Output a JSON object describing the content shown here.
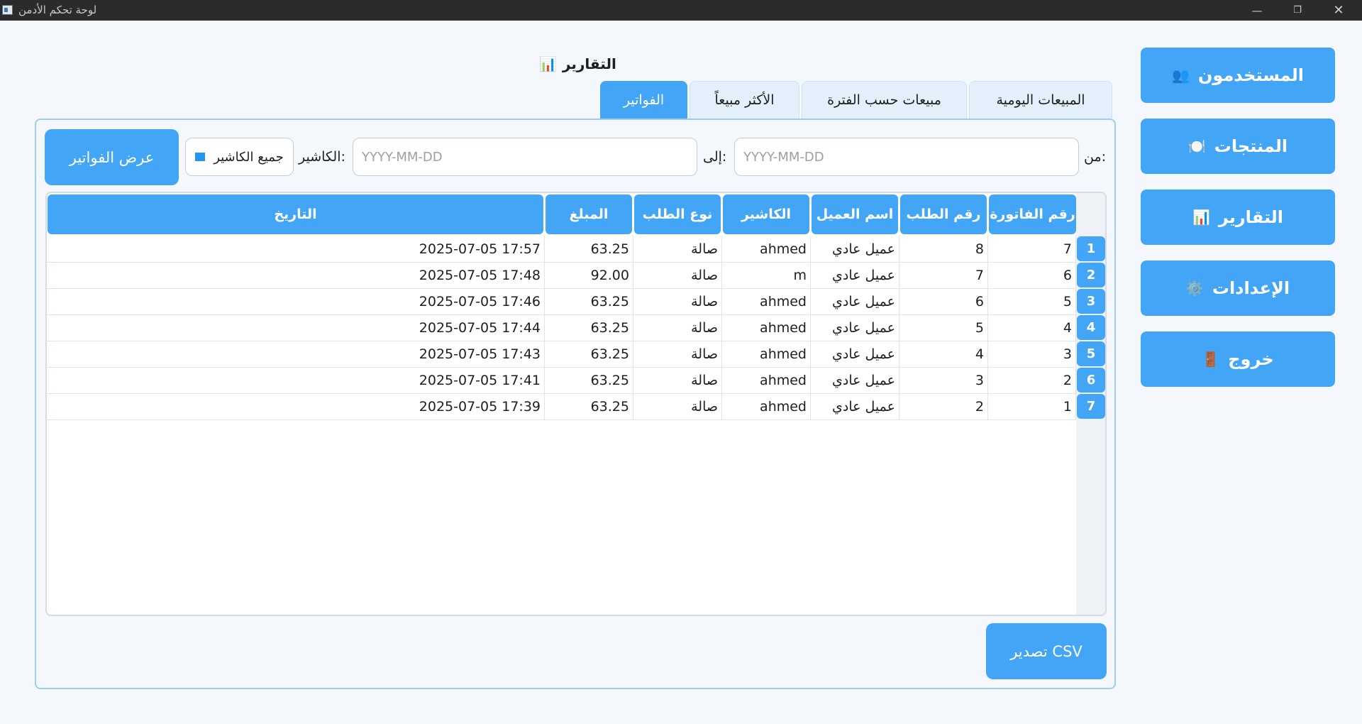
{
  "window": {
    "title": "لوحة تحكم الأدمن"
  },
  "sidebar": {
    "items": [
      {
        "label": "المستخدمون",
        "icon": "👥"
      },
      {
        "label": "المنتجات",
        "icon": "🍽️"
      },
      {
        "label": "التقارير",
        "icon": "📊"
      },
      {
        "label": "الإعدادات",
        "icon": "⚙️"
      },
      {
        "label": "خروج",
        "icon": "🚪"
      }
    ]
  },
  "section": {
    "title": "التقارير",
    "icon": "📊"
  },
  "tabs": [
    {
      "label": "المبيعات اليومية",
      "active": false
    },
    {
      "label": "مبيعات حسب الفترة",
      "active": false
    },
    {
      "label": "الأكثر مبيعاً",
      "active": false
    },
    {
      "label": "الفواتير",
      "active": true
    }
  ],
  "filters": {
    "from_label": "من:",
    "from_placeholder": "YYYY-MM-DD",
    "to_label": "إلى:",
    "to_placeholder": "YYYY-MM-DD",
    "cashier_label": "الكاشير:",
    "cashier_value": "جميع الكاشير",
    "show_button": "عرض الفواتير"
  },
  "table": {
    "headers": [
      "رقم الفاتورة",
      "رقم الطلب",
      "اسم العميل",
      "الكاشير",
      "نوع الطلب",
      "المبلغ",
      "التاريخ"
    ],
    "row_numbers": [
      "1",
      "2",
      "3",
      "4",
      "5",
      "6",
      "7"
    ],
    "rows": [
      [
        "7",
        "8",
        "عميل عادي",
        "ahmed",
        "صالة",
        "63.25",
        "2025-07-05 17:57"
      ],
      [
        "6",
        "7",
        "عميل عادي",
        "m",
        "صالة",
        "92.00",
        "2025-07-05 17:48"
      ],
      [
        "5",
        "6",
        "عميل عادي",
        "ahmed",
        "صالة",
        "63.25",
        "2025-07-05 17:46"
      ],
      [
        "4",
        "5",
        "عميل عادي",
        "ahmed",
        "صالة",
        "63.25",
        "2025-07-05 17:44"
      ],
      [
        "3",
        "4",
        "عميل عادي",
        "ahmed",
        "صالة",
        "63.25",
        "2025-07-05 17:43"
      ],
      [
        "2",
        "3",
        "عميل عادي",
        "ahmed",
        "صالة",
        "63.25",
        "2025-07-05 17:41"
      ],
      [
        "1",
        "2",
        "عميل عادي",
        "ahmed",
        "صالة",
        "63.25",
        "2025-07-05 17:39"
      ]
    ]
  },
  "export_button": "تصدير CSV",
  "colors": {
    "accent": "#42a5f5",
    "titlebar": "#2b2b2b",
    "background": "#f4f8fc"
  }
}
